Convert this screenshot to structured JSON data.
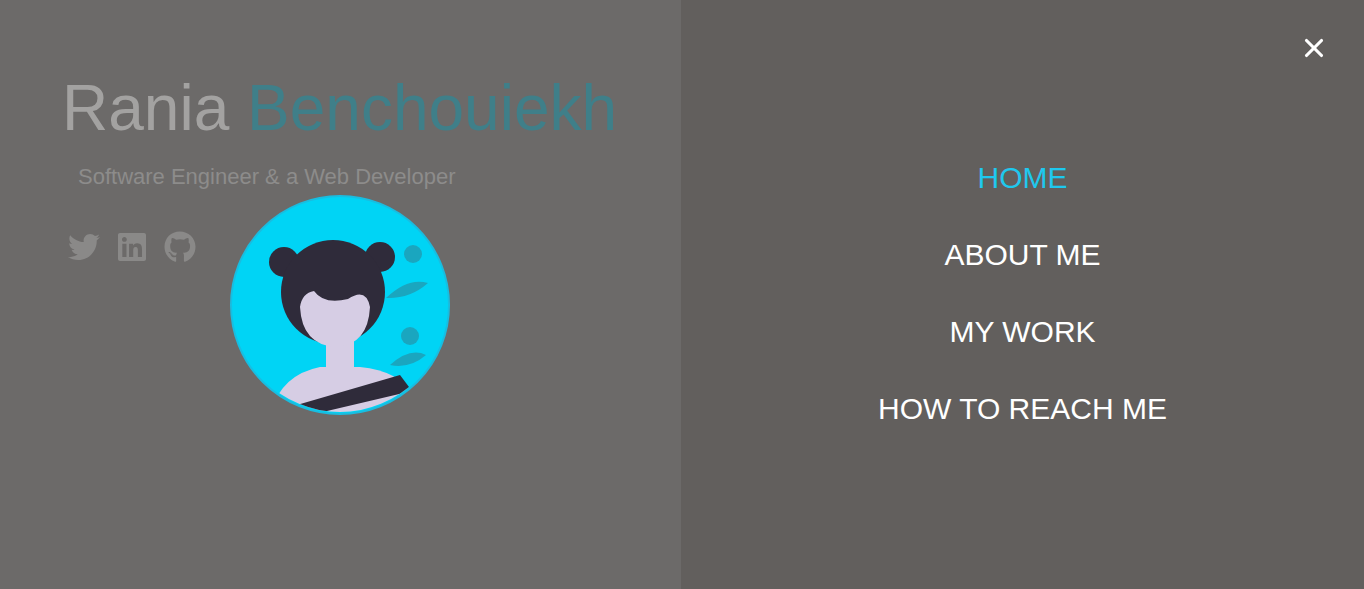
{
  "hero": {
    "first_name": "Rania",
    "last_name": "Benchouiekh",
    "tagline": "Software Engineer & a Web Developer"
  },
  "menu": {
    "items": [
      {
        "label": "HOME",
        "selected": true
      },
      {
        "label": "ABOUT ME",
        "selected": false
      },
      {
        "label": "MY WORK",
        "selected": false
      },
      {
        "label": "HOW TO REACH ME",
        "selected": false
      }
    ]
  }
}
